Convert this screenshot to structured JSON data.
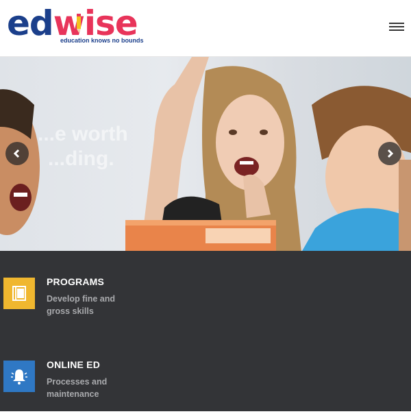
{
  "header": {
    "logo": {
      "part1": "ed",
      "part2": "wise",
      "tagline": "education knows no bounds"
    },
    "menu_icon": "hamburger-menu-icon"
  },
  "hero": {
    "overlay_text_line1": "...e worth",
    "overlay_text_line2": "...ding.",
    "prev_icon": "chevron-left-icon",
    "next_icon": "chevron-right-icon"
  },
  "features": [
    {
      "title": "PROGRAMS",
      "description": "Develop fine and gross skills",
      "icon": "book-icon",
      "icon_color": "#f0b72f"
    },
    {
      "title": "ONLINE ED",
      "description": "Processes and maintenance",
      "icon": "bell-icon",
      "icon_color": "#2f78c4"
    }
  ],
  "colors": {
    "brand_blue": "#1b3f8b",
    "brand_pink": "#e8345a",
    "features_bg": "#333437"
  }
}
